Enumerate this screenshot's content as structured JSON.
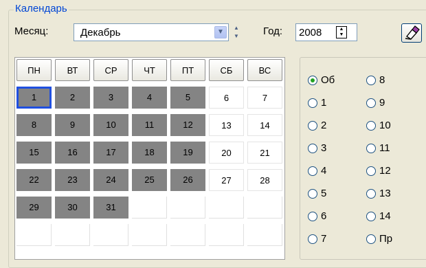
{
  "group": {
    "legend": "Календарь"
  },
  "month": {
    "label": "Месяц:",
    "value": "Декабрь"
  },
  "year": {
    "label": "Год:",
    "value": "2008"
  },
  "weekdays": [
    "ПН",
    "ВТ",
    "СР",
    "ЧТ",
    "ПТ",
    "СБ",
    "ВС"
  ],
  "days": [
    "1",
    "2",
    "3",
    "4",
    "5",
    "6",
    "7",
    "8",
    "9",
    "10",
    "11",
    "12",
    "13",
    "14",
    "15",
    "16",
    "17",
    "18",
    "19",
    "20",
    "21",
    "22",
    "23",
    "24",
    "25",
    "26",
    "27",
    "28",
    "29",
    "30",
    "31"
  ],
  "selected_day": "1",
  "radios": [
    {
      "label": "Об",
      "checked": true
    },
    {
      "label": "1",
      "checked": false
    },
    {
      "label": "2",
      "checked": false
    },
    {
      "label": "3",
      "checked": false
    },
    {
      "label": "4",
      "checked": false
    },
    {
      "label": "5",
      "checked": false
    },
    {
      "label": "6",
      "checked": false
    },
    {
      "label": "7",
      "checked": false
    },
    {
      "label": "8",
      "checked": false
    },
    {
      "label": "9",
      "checked": false
    },
    {
      "label": "10",
      "checked": false
    },
    {
      "label": "11",
      "checked": false
    },
    {
      "label": "12",
      "checked": false
    },
    {
      "label": "13",
      "checked": false
    },
    {
      "label": "14",
      "checked": false
    },
    {
      "label": "Пр",
      "checked": false
    }
  ],
  "icons": {
    "month_dropdown": "chevron-down-icon",
    "month_spin": "spinner-icon",
    "year_spin": "spinner-icon",
    "clear": "eraser-icon"
  }
}
